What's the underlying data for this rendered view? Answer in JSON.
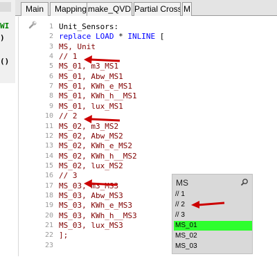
{
  "left_fragment": {
    "lines": [
      "WI",
      ")",
      "()"
    ]
  },
  "tabs": [
    "Main",
    "Mapping",
    "make_QVD",
    "Partial Cross",
    "M"
  ],
  "editor": {
    "lines": [
      {
        "n": "1",
        "text": "Unit_Sensors:"
      },
      {
        "n": "2",
        "kw1": "replace LOAD",
        "mid": " * ",
        "kw2": "INLINE",
        "rest": " ["
      },
      {
        "n": "3",
        "text": "MS, Unit"
      },
      {
        "n": "4",
        "text": "// 1"
      },
      {
        "n": "5",
        "text": "MS_01, m3_MS1"
      },
      {
        "n": "6",
        "text": "MS_01, Abw_MS1"
      },
      {
        "n": "7",
        "text": "MS_01, KWh_e_MS1"
      },
      {
        "n": "8",
        "text": "MS_01, KWh_h__MS1"
      },
      {
        "n": "9",
        "text": "MS_01, lux_MS1"
      },
      {
        "n": "10",
        "text": "// 2"
      },
      {
        "n": "11",
        "text": "MS_02, m3_MS2"
      },
      {
        "n": "12",
        "text": "MS_02, Abw_MS2"
      },
      {
        "n": "13",
        "text": "MS_02, KWh_e_MS2"
      },
      {
        "n": "14",
        "text": "MS_02, KWh_h__MS2"
      },
      {
        "n": "15",
        "text": "MS_02, lux_MS2"
      },
      {
        "n": "16",
        "text": "// 3"
      },
      {
        "n": "17",
        "text": "MS_03, m3_MS3"
      },
      {
        "n": "18",
        "text": "MS_03, Abw_MS3"
      },
      {
        "n": "19",
        "text": "MS_03, KWh_e_MS3"
      },
      {
        "n": "20",
        "text": "MS_03, KWh_h__MS3"
      },
      {
        "n": "21",
        "text": "MS_03, lux_MS3"
      },
      {
        "n": "22",
        "text": "];"
      },
      {
        "n": "23",
        "text": ""
      }
    ]
  },
  "listbox": {
    "title": "MS",
    "items": [
      "// 1",
      "// 2",
      "// 3",
      "MS_01",
      "MS_02",
      "MS_03"
    ],
    "selected_index": 3
  },
  "colors": {
    "code_text": "#800000",
    "keyword": "#0000ff",
    "arrow": "#cc0000",
    "selected": "#2eff2e",
    "listbox_bg": "#d9d9d9"
  },
  "icons": [
    "wrench-icon",
    "search-icon",
    "arrow-icon"
  ]
}
